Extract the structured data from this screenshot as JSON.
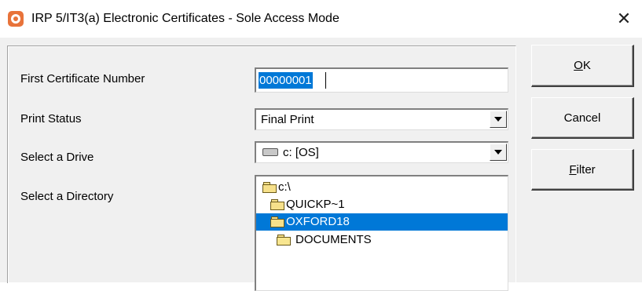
{
  "window": {
    "title": "IRP 5/IT3(a) Electronic Certificates - Sole Access Mode",
    "close_label": "✕"
  },
  "form": {
    "first_certificate_label": "First Certificate Number",
    "first_certificate_value": "00000001",
    "print_status_label": "Print Status",
    "print_status_value": "Final Print",
    "drive_label": "Select a Drive",
    "drive_value": "c: [OS]",
    "directory_label": "Select a Directory",
    "directories": [
      {
        "name": "c:\\"
      },
      {
        "name": "QUICKP~1"
      },
      {
        "name": "OXFORD18"
      },
      {
        "name": "DOCUMENTS"
      }
    ],
    "selected_directory": "OXFORD18"
  },
  "buttons": {
    "ok_mnemonic": "O",
    "ok_rest": "K",
    "cancel_label": "Cancel",
    "filter_mnemonic": "F",
    "filter_rest": "ilter"
  },
  "icons": {
    "app": "app-logo-icon",
    "drive": "hard-drive-icon",
    "folder_open": "folder-open-icon",
    "folder_closed": "folder-closed-icon",
    "dropdown": "chevron-down-icon"
  },
  "colors": {
    "selection": "#0078d7",
    "window_bg": "#f0f0f0",
    "brand": "#e8733a"
  }
}
